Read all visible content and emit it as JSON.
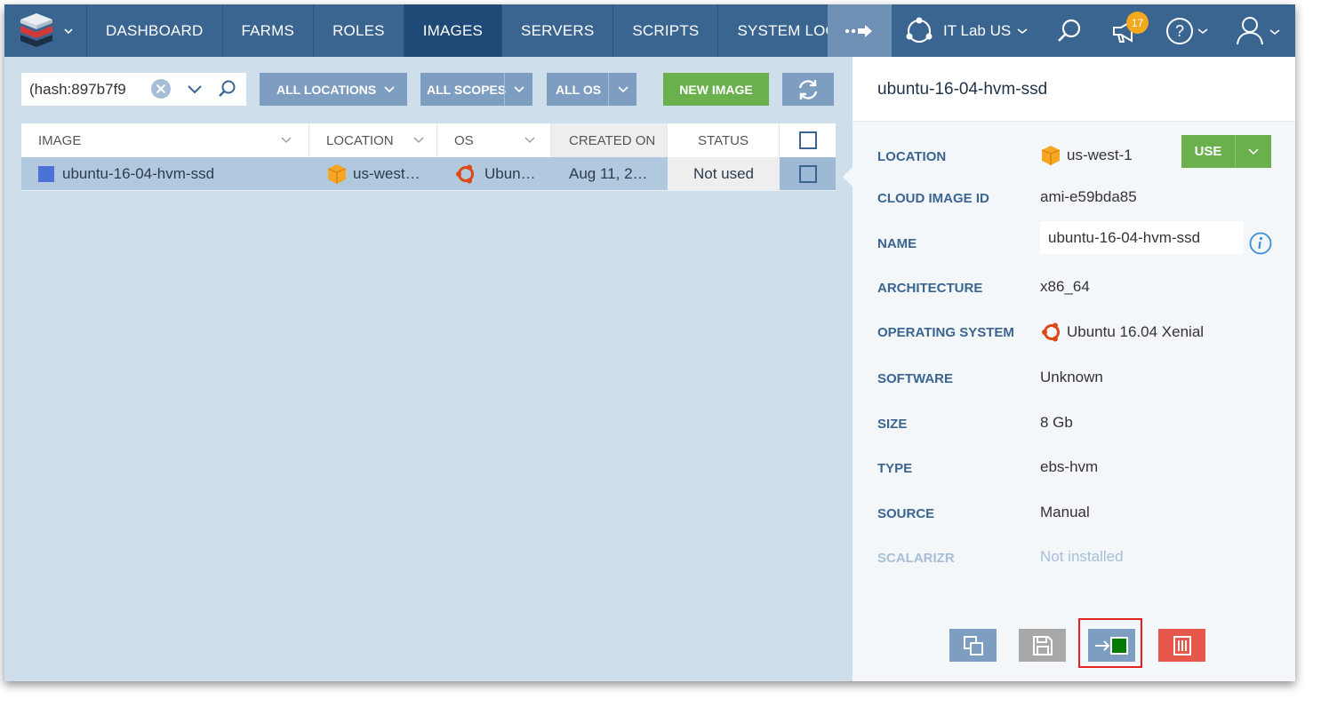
{
  "nav": {
    "items": [
      {
        "label": "DASHBOARD",
        "active": false
      },
      {
        "label": "FARMS",
        "active": false
      },
      {
        "label": "ROLES",
        "active": false
      },
      {
        "label": "IMAGES",
        "active": true
      },
      {
        "label": "SERVERS",
        "active": false
      },
      {
        "label": "SCRIPTS",
        "active": false
      },
      {
        "label": "SYSTEM LOG",
        "active": false
      }
    ],
    "environment": "IT Lab US",
    "notification_count": "17"
  },
  "filters": {
    "search_value": "(hash:897b7f9",
    "locations": "ALL LOCATIONS",
    "scopes": "ALL SCOPES",
    "os": "ALL OS",
    "new_image": "NEW IMAGE"
  },
  "table": {
    "headers": [
      "IMAGE",
      "LOCATION",
      "OS",
      "CREATED ON",
      "STATUS"
    ],
    "rows": [
      {
        "image": "ubuntu-16-04-hvm-ssd",
        "location": "us-west…",
        "os": "Ubun…",
        "created": "Aug 11, 2…",
        "status": "Not used"
      }
    ]
  },
  "panel": {
    "title": "ubuntu-16-04-hvm-ssd",
    "use_label": "USE",
    "fields": [
      {
        "label": "LOCATION",
        "value": "us-west-1"
      },
      {
        "label": "CLOUD IMAGE ID",
        "value": "ami-e59bda85"
      },
      {
        "label": "NAME",
        "value": "ubuntu-16-04-hvm-ssd"
      },
      {
        "label": "ARCHITECTURE",
        "value": "x86_64"
      },
      {
        "label": "OPERATING SYSTEM",
        "value": "Ubuntu 16.04 Xenial"
      },
      {
        "label": "SOFTWARE",
        "value": "Unknown"
      },
      {
        "label": "SIZE",
        "value": "8 Gb"
      },
      {
        "label": "TYPE",
        "value": "ebs-hvm"
      },
      {
        "label": "SOURCE",
        "value": "Manual"
      },
      {
        "label": "SCALARIZR",
        "value": "Not installed"
      }
    ]
  },
  "colors": {
    "nav": "#3a6591",
    "nav_active": "#1f4a78",
    "accent_green": "#6ab04c",
    "danger": "#e8574b",
    "badge": "#f4a81d"
  }
}
